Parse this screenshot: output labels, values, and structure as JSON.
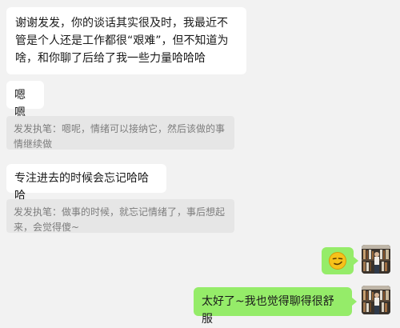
{
  "messages": [
    {
      "text": "谢谢发发，你的谈话其实很及时，我最近不管是个人还是工作都很“艰难”，但不知道为啥，和你聊了后给了我一些力量哈哈哈"
    },
    {
      "text": "嗯嗯"
    },
    {
      "quote": "发发执笔：嗯呢，情绪可以接纳它，然后该做的事情继续做"
    },
    {
      "text": "专注进去的时候会忘记哈哈哈"
    },
    {
      "quote": "发发执笔：做事的时候，就忘记情绪了，事后想起来，会觉得傻~"
    },
    {
      "emoji": "smirk-emoji"
    },
    {
      "text": "太好了~我也觉得聊得很舒服"
    }
  ],
  "colors": {
    "background": "#f2f2f2",
    "incoming_bubble": "#ffffff",
    "outgoing_bubble": "#95ec69",
    "quote_bg": "#e6e6e6",
    "quote_text": "#7d7d7d"
  }
}
